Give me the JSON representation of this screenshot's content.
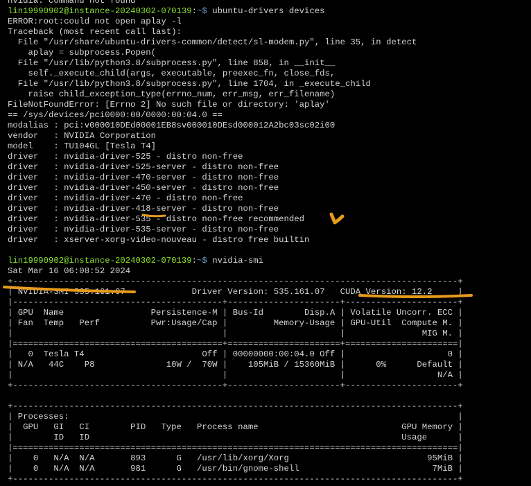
{
  "terminal": {
    "lines": [
      {
        "text": "nvidia: command not found"
      },
      {
        "prompt": {
          "user": "lin19990902@instance-20240302-070139",
          "sep": ":",
          "path": "~$",
          "command": " ubuntu-drivers devices"
        }
      },
      {
        "text": "ERROR:root:could not open aplay -l"
      },
      {
        "text": "Traceback (most recent call last):"
      },
      {
        "text": "  File \"/usr/share/ubuntu-drivers-common/detect/sl-modem.py\", line 35, in detect"
      },
      {
        "text": "    aplay = subprocess.Popen("
      },
      {
        "text": "  File \"/usr/lib/python3.8/subprocess.py\", line 858, in __init__"
      },
      {
        "text": "    self._execute_child(args, executable, preexec_fn, close_fds,"
      },
      {
        "text": "  File \"/usr/lib/python3.8/subprocess.py\", line 1704, in _execute_child"
      },
      {
        "text": "    raise child_exception_type(errno_num, err_msg, err_filename)"
      },
      {
        "text": "FileNotFoundError: [Errno 2] No such file or directory: 'aplay'"
      },
      {
        "text": "== /sys/devices/pci0000:00/0000:00:04.0 =="
      },
      {
        "text": "modalias : pci:v000010DEd00001EB8sv000010DEsd000012A2bc03sc02i00"
      },
      {
        "text": "vendor   : NVIDIA Corporation"
      },
      {
        "text": "model    : TU104GL [Tesla T4]"
      },
      {
        "text": "driver   : nvidia-driver-525 - distro non-free"
      },
      {
        "text": "driver   : nvidia-driver-525-server - distro non-free"
      },
      {
        "text": "driver   : nvidia-driver-470-server - distro non-free"
      },
      {
        "text": "driver   : nvidia-driver-450-server - distro non-free"
      },
      {
        "text": "driver   : nvidia-driver-470 - distro non-free"
      },
      {
        "text": "driver   : nvidia-driver-418-server - distro non-free"
      },
      {
        "text": "driver   : nvidia-driver-535 - distro non-free recommended"
      },
      {
        "text": "driver   : nvidia-driver-535-server - distro non-free"
      },
      {
        "text": "driver   : xserver-xorg-video-nouveau - distro free builtin"
      },
      {
        "text": ""
      },
      {
        "prompt": {
          "user": "lin19990902@instance-20240302-070139",
          "sep": ":",
          "path": "~$",
          "command": " nvidia-smi"
        }
      },
      {
        "text": "Sat Mar 16 06:08:52 2024"
      },
      {
        "text": "+---------------------------------------------------------------------------------------+"
      },
      {
        "text": "| NVIDIA-SMI 535.161.07             Driver Version: 535.161.07   CUDA Version: 12.2     |"
      },
      {
        "text": "|-----------------------------------------+----------------------+----------------------+"
      },
      {
        "text": "| GPU  Name                 Persistence-M | Bus-Id        Disp.A | Volatile Uncorr. ECC |"
      },
      {
        "text": "| Fan  Temp   Perf          Pwr:Usage/Cap |         Memory-Usage | GPU-Util  Compute M. |"
      },
      {
        "text": "|                                         |                      |               MIG M. |"
      },
      {
        "text": "|=========================================+======================+======================|"
      },
      {
        "text": "|   0  Tesla T4                       Off | 00000000:00:04.0 Off |                    0 |"
      },
      {
        "text": "| N/A   44C    P8              10W /  70W |    105MiB / 15360MiB |      0%      Default |"
      },
      {
        "text": "|                                         |                      |                  N/A |"
      },
      {
        "text": "+-----------------------------------------+----------------------+----------------------+"
      },
      {
        "text": ""
      },
      {
        "text": "+---------------------------------------------------------------------------------------+"
      },
      {
        "text": "| Processes:                                                                            |"
      },
      {
        "text": "|  GPU   GI   CI        PID   Type   Process name                            GPU Memory |"
      },
      {
        "text": "|        ID   ID                                                             Usage      |"
      },
      {
        "text": "|=======================================================================================|"
      },
      {
        "text": "|    0   N/A  N/A       893      G   /usr/lib/xorg/Xorg                           95MiB |"
      },
      {
        "text": "|    0   N/A  N/A       981      G   /usr/bin/gnome-shell                          7MiB |"
      },
      {
        "text": "+---------------------------------------------------------------------------------------+"
      }
    ]
  },
  "colors": {
    "background": "#000000",
    "text": "#d3d3d3",
    "prompt_user": "#8ae234",
    "prompt_path": "#729fcf",
    "annotation": "#e69a1c"
  }
}
